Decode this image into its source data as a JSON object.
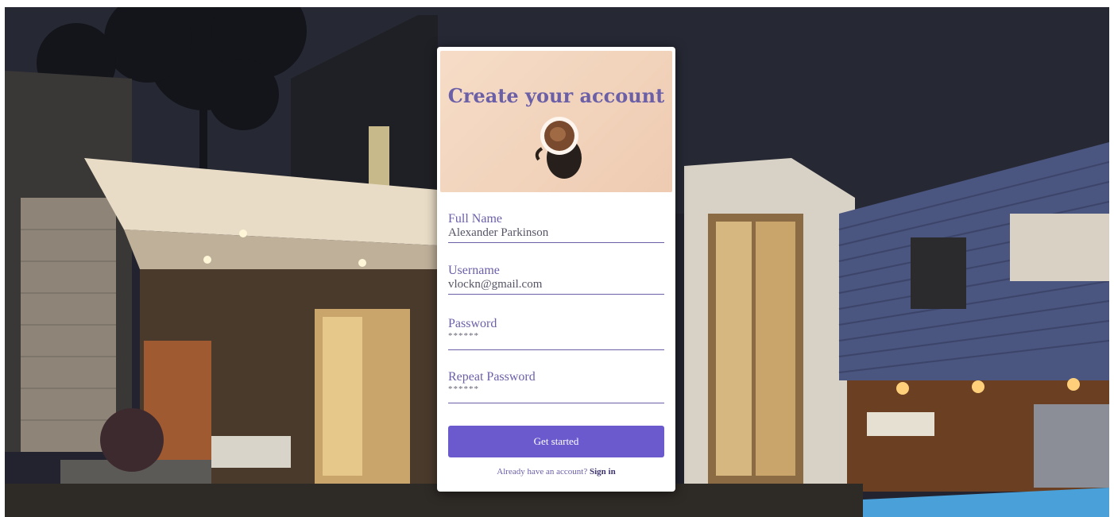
{
  "form": {
    "title": "Create your account",
    "fields": [
      {
        "label": "Full Name",
        "value": "Alexander Parkinson"
      },
      {
        "label": "Username",
        "value": "vlockn@gmail.com"
      },
      {
        "label": "Password",
        "value": "******"
      },
      {
        "label": "Repeat Password",
        "value": "******"
      }
    ],
    "submit_label": "Get started",
    "signin_prompt": "Already have an account?",
    "signin_link": "Sign in"
  },
  "colors": {
    "accent": "#6a5acd",
    "label": "#6b5fa8",
    "hero_bg": "#f2d4bc"
  },
  "icons": {
    "hero": "coffee-cup-icon"
  }
}
